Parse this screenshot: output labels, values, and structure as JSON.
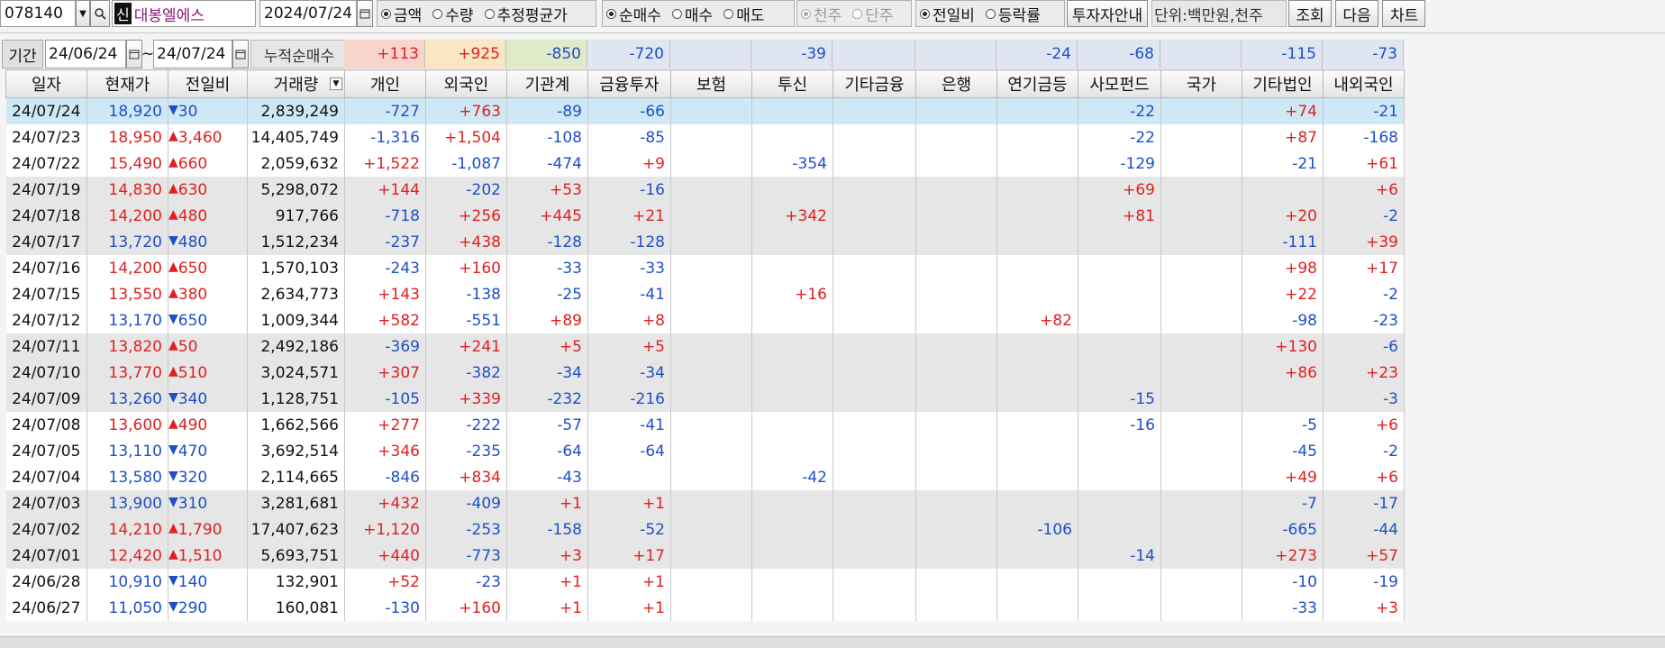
{
  "toolbar": {
    "code": "078140",
    "badge": "신",
    "name": "대봉엘에스",
    "date": "2024/07/24",
    "radio_amount": [
      {
        "label": "금액",
        "on": true
      },
      {
        "label": "수량",
        "on": false
      },
      {
        "label": "추정평균가",
        "on": false
      }
    ],
    "radio_trade": [
      {
        "label": "순매수",
        "on": true
      },
      {
        "label": "매수",
        "on": false
      },
      {
        "label": "매도",
        "on": false
      }
    ],
    "radio_unit": [
      {
        "label": "천주",
        "on": true
      },
      {
        "label": "단주",
        "on": false
      }
    ],
    "radio_compare": [
      {
        "label": "전일비",
        "on": true
      },
      {
        "label": "등락률",
        "on": false
      }
    ],
    "guide_button": "투자자안내",
    "unit_text": "단위:백만원,천주",
    "query_button": "조회",
    "next_button": "다음",
    "chart_button": "차트"
  },
  "period": {
    "label": "기간",
    "from": "24/06/24",
    "tilde": "~",
    "to": "24/07/24",
    "cum_label": "누적순매수",
    "sums": [
      "+113",
      "+925",
      "-850",
      "-720",
      "",
      "-39",
      "",
      "",
      "-24",
      "-68",
      "",
      "-115",
      "-73"
    ]
  },
  "columns": [
    "일자",
    "현재가",
    "전일비",
    "거래량",
    "개인",
    "외국인",
    "기관계",
    "금융투자",
    "보험",
    "투신",
    "기타금융",
    "은행",
    "연기금등",
    "사모펀드",
    "국가",
    "기타법인",
    "내외국인"
  ],
  "rows": [
    {
      "date": "24/07/24",
      "price": "18,920",
      "dir": "down",
      "chg": "30",
      "vol": "2,839,249",
      "v": [
        "-727",
        "+763",
        "-89",
        "-66",
        "",
        "",
        "",
        "",
        "",
        "-22",
        "",
        "+74",
        "-21"
      ]
    },
    {
      "date": "24/07/23",
      "price": "18,950",
      "dir": "up",
      "chg": "3,460",
      "vol": "14,405,749",
      "v": [
        "-1,316",
        "+1,504",
        "-108",
        "-85",
        "",
        "",
        "",
        "",
        "",
        "-22",
        "",
        "+87",
        "-168"
      ]
    },
    {
      "date": "24/07/22",
      "price": "15,490",
      "dir": "up",
      "chg": "660",
      "vol": "2,059,632",
      "v": [
        "+1,522",
        "-1,087",
        "-474",
        "+9",
        "",
        "-354",
        "",
        "",
        "",
        "-129",
        "",
        "-21",
        "+61"
      ]
    },
    {
      "date": "24/07/19",
      "price": "14,830",
      "dir": "up",
      "chg": "630",
      "vol": "5,298,072",
      "v": [
        "+144",
        "-202",
        "+53",
        "-16",
        "",
        "",
        "",
        "",
        "",
        "+69",
        "",
        "",
        "+6"
      ]
    },
    {
      "date": "24/07/18",
      "price": "14,200",
      "dir": "up",
      "chg": "480",
      "vol": "917,766",
      "v": [
        "-718",
        "+256",
        "+445",
        "+21",
        "",
        "+342",
        "",
        "",
        "",
        "+81",
        "",
        "+20",
        "-2"
      ]
    },
    {
      "date": "24/07/17",
      "price": "13,720",
      "dir": "down",
      "chg": "480",
      "vol": "1,512,234",
      "v": [
        "-237",
        "+438",
        "-128",
        "-128",
        "",
        "",
        "",
        "",
        "",
        "",
        "",
        "-111",
        "+39"
      ]
    },
    {
      "date": "24/07/16",
      "price": "14,200",
      "dir": "up",
      "chg": "650",
      "vol": "1,570,103",
      "v": [
        "-243",
        "+160",
        "-33",
        "-33",
        "",
        "",
        "",
        "",
        "",
        "",
        "",
        "+98",
        "+17"
      ]
    },
    {
      "date": "24/07/15",
      "price": "13,550",
      "dir": "up",
      "chg": "380",
      "vol": "2,634,773",
      "v": [
        "+143",
        "-138",
        "-25",
        "-41",
        "",
        "+16",
        "",
        "",
        "",
        "",
        "",
        "+22",
        "-2"
      ]
    },
    {
      "date": "24/07/12",
      "price": "13,170",
      "dir": "down",
      "chg": "650",
      "vol": "1,009,344",
      "v": [
        "+582",
        "-551",
        "+89",
        "+8",
        "",
        "",
        "",
        "",
        "+82",
        "",
        "",
        "-98",
        "-23"
      ]
    },
    {
      "date": "24/07/11",
      "price": "13,820",
      "dir": "up",
      "chg": "50",
      "vol": "2,492,186",
      "v": [
        "-369",
        "+241",
        "+5",
        "+5",
        "",
        "",
        "",
        "",
        "",
        "",
        "",
        "+130",
        "-6"
      ]
    },
    {
      "date": "24/07/10",
      "price": "13,770",
      "dir": "up",
      "chg": "510",
      "vol": "3,024,571",
      "v": [
        "+307",
        "-382",
        "-34",
        "-34",
        "",
        "",
        "",
        "",
        "",
        "",
        "",
        "+86",
        "+23"
      ]
    },
    {
      "date": "24/07/09",
      "price": "13,260",
      "dir": "down",
      "chg": "340",
      "vol": "1,128,751",
      "v": [
        "-105",
        "+339",
        "-232",
        "-216",
        "",
        "",
        "",
        "",
        "",
        "-15",
        "",
        "",
        "-3"
      ]
    },
    {
      "date": "24/07/08",
      "price": "13,600",
      "dir": "up",
      "chg": "490",
      "vol": "1,662,566",
      "v": [
        "+277",
        "-222",
        "-57",
        "-41",
        "",
        "",
        "",
        "",
        "",
        "-16",
        "",
        "-5",
        "+6"
      ]
    },
    {
      "date": "24/07/05",
      "price": "13,110",
      "dir": "down",
      "chg": "470",
      "vol": "3,692,514",
      "v": [
        "+346",
        "-235",
        "-64",
        "-64",
        "",
        "",
        "",
        "",
        "",
        "",
        "",
        "-45",
        "-2"
      ]
    },
    {
      "date": "24/07/04",
      "price": "13,580",
      "dir": "down",
      "chg": "320",
      "vol": "2,114,665",
      "v": [
        "-846",
        "+834",
        "-43",
        "",
        "",
        "-42",
        "",
        "",
        "",
        "",
        "",
        "+49",
        "+6"
      ]
    },
    {
      "date": "24/07/03",
      "price": "13,900",
      "dir": "down",
      "chg": "310",
      "vol": "3,281,681",
      "v": [
        "+432",
        "-409",
        "+1",
        "+1",
        "",
        "",
        "",
        "",
        "",
        "",
        "",
        "-7",
        "-17"
      ]
    },
    {
      "date": "24/07/02",
      "price": "14,210",
      "dir": "up",
      "chg": "1,790",
      "vol": "17,407,623",
      "v": [
        "+1,120",
        "-253",
        "-158",
        "-52",
        "",
        "",
        "",
        "",
        "-106",
        "",
        "",
        "-665",
        "-44"
      ]
    },
    {
      "date": "24/07/01",
      "price": "12,420",
      "dir": "up",
      "chg": "1,510",
      "vol": "5,693,751",
      "v": [
        "+440",
        "-773",
        "+3",
        "+17",
        "",
        "",
        "",
        "",
        "",
        "-14",
        "",
        "+273",
        "+57"
      ]
    },
    {
      "date": "24/06/28",
      "price": "10,910",
      "dir": "down",
      "chg": "140",
      "vol": "132,901",
      "v": [
        "+52",
        "-23",
        "+1",
        "+1",
        "",
        "",
        "",
        "",
        "",
        "",
        "",
        "-10",
        "-19"
      ]
    },
    {
      "date": "24/06/27",
      "price": "11,050",
      "dir": "down",
      "chg": "290",
      "vol": "160,081",
      "v": [
        "-130",
        "+160",
        "+1",
        "+1",
        "",
        "",
        "",
        "",
        "",
        "",
        "",
        "-33",
        "+3"
      ]
    }
  ],
  "row_shading": [
    "sel",
    "white",
    "white",
    "gray",
    "gray",
    "gray",
    "white",
    "white",
    "white",
    "gray",
    "gray",
    "gray",
    "white",
    "white",
    "white",
    "gray",
    "gray",
    "gray",
    "white",
    "white"
  ],
  "colors": {
    "up": "#e02020",
    "down": "#1e4fc6",
    "selected_row": "#cfe8f6",
    "shaded_row": "#e6e6e6",
    "sum_pink": "#f8d4cc",
    "sum_yellow": "#fbe6c4",
    "sum_green": "#dfeac8",
    "sum_blue": "#dfe6f2"
  },
  "icons": {
    "dropdown": "chevron-down-icon",
    "search": "search-icon",
    "calendar": "calendar-icon",
    "up": "triangle-up-icon",
    "down": "triangle-down-icon"
  }
}
